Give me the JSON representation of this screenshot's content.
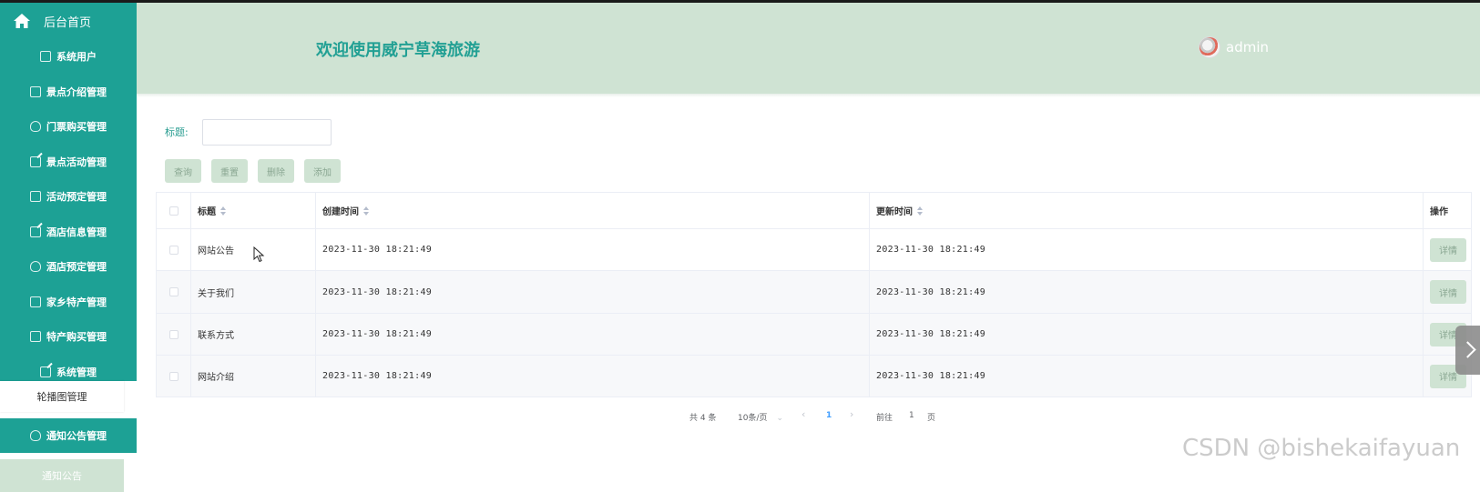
{
  "sidebar": {
    "home": "后台首页",
    "items": [
      {
        "label": "系统用户",
        "icon": "user-icon"
      },
      {
        "label": "景点介绍管理",
        "icon": "doc-icon"
      },
      {
        "label": "门票购买管理",
        "icon": "cloud-icon"
      },
      {
        "label": "景点活动管理",
        "icon": "edit-icon"
      },
      {
        "label": "活动预定管理",
        "icon": "doc-icon"
      },
      {
        "label": "酒店信息管理",
        "icon": "edit-icon"
      },
      {
        "label": "酒店预定管理",
        "icon": "cloud-icon"
      },
      {
        "label": "家乡特产管理",
        "icon": "doc-icon"
      },
      {
        "label": "特产购买管理",
        "icon": "user-icon"
      },
      {
        "label": "系统管理",
        "icon": "edit-icon"
      }
    ],
    "submenu": "轮播图管理",
    "notice": "通知公告管理",
    "notice_sub": "通知公告"
  },
  "header": {
    "welcome": "欢迎使用威宁草海旅游",
    "user": "admin"
  },
  "search": {
    "label": "标题:",
    "value": "",
    "buttons": [
      "查询",
      "重置",
      "删除",
      "添加"
    ]
  },
  "table": {
    "columns": [
      "标题",
      "创建时间",
      "更新时间",
      "操作"
    ],
    "rows": [
      {
        "title": "网站公告",
        "created": "2023-11-30 18:21:49",
        "updated": "2023-11-30 18:21:49",
        "action": "详情"
      },
      {
        "title": "关于我们",
        "created": "2023-11-30 18:21:49",
        "updated": "2023-11-30 18:21:49",
        "action": "详情"
      },
      {
        "title": "联系方式",
        "created": "2023-11-30 18:21:49",
        "updated": "2023-11-30 18:21:49",
        "action": "详情"
      },
      {
        "title": "网站介绍",
        "created": "2023-11-30 18:21:49",
        "updated": "2023-11-30 18:21:49",
        "action": "详情"
      }
    ]
  },
  "pagination": {
    "total": "共 4 条",
    "page_size": "10条/页",
    "current_page": "1",
    "goto_prefix": "前往",
    "goto_value": "1",
    "goto_suffix": "页"
  },
  "watermark": "CSDN @bishekaifayuan"
}
